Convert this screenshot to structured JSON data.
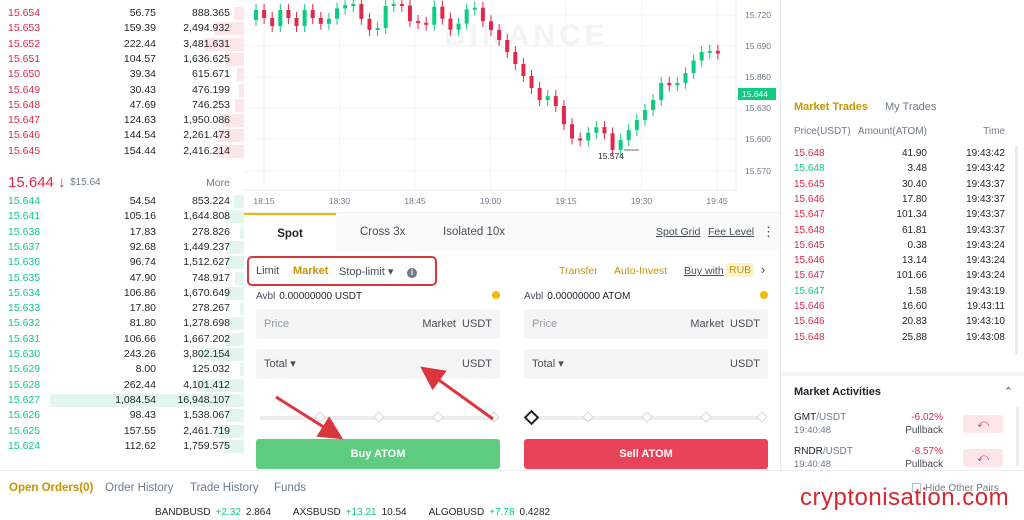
{
  "orderbook": {
    "asks": [
      {
        "price": "15.654",
        "amount": "56.75",
        "total": "888.365"
      },
      {
        "price": "15.653",
        "amount": "159.39",
        "total": "2,494.932"
      },
      {
        "price": "15.652",
        "amount": "222.44",
        "total": "3,481.631"
      },
      {
        "price": "15.651",
        "amount": "104.57",
        "total": "1,636.625"
      },
      {
        "price": "15.650",
        "amount": "39.34",
        "total": "615.671"
      },
      {
        "price": "15.649",
        "amount": "30.43",
        "total": "476.199"
      },
      {
        "price": "15.648",
        "amount": "47.69",
        "total": "746.253"
      },
      {
        "price": "15.647",
        "amount": "124.63",
        "total": "1,950.086"
      },
      {
        "price": "15.646",
        "amount": "144.54",
        "total": "2,261.473"
      },
      {
        "price": "15.645",
        "amount": "154.44",
        "total": "2,416.214"
      }
    ],
    "last_price": "15.644 ↓",
    "last_fiat": "$15.64",
    "more_label": "More",
    "bids": [
      {
        "price": "15.644",
        "amount": "54.54",
        "total": "853.224"
      },
      {
        "price": "15.641",
        "amount": "105.16",
        "total": "1,644.808"
      },
      {
        "price": "15.638",
        "amount": "17.83",
        "total": "278.826"
      },
      {
        "price": "15.637",
        "amount": "92.68",
        "total": "1,449.237"
      },
      {
        "price": "15.636",
        "amount": "96.74",
        "total": "1,512.627"
      },
      {
        "price": "15.635",
        "amount": "47.90",
        "total": "748.917"
      },
      {
        "price": "15.634",
        "amount": "106.86",
        "total": "1,670.649"
      },
      {
        "price": "15.633",
        "amount": "17.80",
        "total": "278.267"
      },
      {
        "price": "15.632",
        "amount": "81.80",
        "total": "1,278.698"
      },
      {
        "price": "15.631",
        "amount": "106.66",
        "total": "1,667.202"
      },
      {
        "price": "15.630",
        "amount": "243.26",
        "total": "3,802.154"
      },
      {
        "price": "15.629",
        "amount": "8.00",
        "total": "125.032"
      },
      {
        "price": "15.628",
        "amount": "262.44",
        "total": "4,101.412"
      },
      {
        "price": "15.627",
        "amount": "1,084.54",
        "total": "16,948.107"
      },
      {
        "price": "15.626",
        "amount": "98.43",
        "total": "1,538.067"
      },
      {
        "price": "15.625",
        "amount": "157.55",
        "total": "2,461.719"
      },
      {
        "price": "15.624",
        "amount": "112.62",
        "total": "1,759.575"
      }
    ]
  },
  "chart": {
    "watermark": "BINANCE",
    "price_ticks": [
      "15.720",
      "15.690",
      "15.860",
      "15.630",
      "15.600",
      "15.570"
    ],
    "current_price": "15.644",
    "low_label": "15.574",
    "time_ticks": [
      "18:15",
      "18:30",
      "18:45",
      "19:00",
      "19:15",
      "19:30",
      "19:45"
    ],
    "colors": {
      "up": "#0ecb81",
      "down": "#e0294a"
    }
  },
  "trade": {
    "tabs": {
      "spot": "Spot",
      "cross": "Cross 3x",
      "isolated": "Isolated 10x"
    },
    "links": {
      "spot_grid": "Spot Grid",
      "fee_level": "Fee Level"
    },
    "order_types": {
      "limit": "Limit",
      "market": "Market",
      "stop_limit": "Stop-limit ▾"
    },
    "info_glyph": "i",
    "options": {
      "transfer": "Transfer",
      "auto_invest": "Auto-Invest",
      "buy_with": "Buy with",
      "currency": "RUB",
      "next": "›"
    },
    "buy": {
      "avbl_label": "Avbl",
      "avbl_value": "0.00000000 USDT",
      "price_label": "Price",
      "price_mode": "Market",
      "price_unit": "USDT",
      "total_label": "Total ▾",
      "total_unit": "USDT",
      "button": "Buy ATOM"
    },
    "sell": {
      "avbl_label": "Avbl",
      "avbl_value": "0.00000000 ATOM",
      "price_label": "Price",
      "price_mode": "Market",
      "price_unit": "USDT",
      "total_label": "Total ▾",
      "total_unit": "USDT",
      "button": "Sell ATOM"
    }
  },
  "trades": {
    "tabs": {
      "market": "Market Trades",
      "mine": "My Trades"
    },
    "headers": {
      "price": "Price(USDT)",
      "amount": "Amount(ATOM)",
      "time": "Time"
    },
    "rows": [
      {
        "price": "15.648",
        "amount": "41.90",
        "time": "19:43:42",
        "side": "sell"
      },
      {
        "price": "15.648",
        "amount": "3.48",
        "time": "19:43:42",
        "side": "buy"
      },
      {
        "price": "15.645",
        "amount": "30.40",
        "time": "19:43:37",
        "side": "sell"
      },
      {
        "price": "15.646",
        "amount": "17.80",
        "time": "19:43:37",
        "side": "sell"
      },
      {
        "price": "15.647",
        "amount": "101.34",
        "time": "19:43:37",
        "side": "sell"
      },
      {
        "price": "15.648",
        "amount": "61.81",
        "time": "19:43:37",
        "side": "sell"
      },
      {
        "price": "15.645",
        "amount": "0.38",
        "time": "19:43:24",
        "side": "sell"
      },
      {
        "price": "15.646",
        "amount": "13.14",
        "time": "19:43:24",
        "side": "sell"
      },
      {
        "price": "15.647",
        "amount": "101.66",
        "time": "19:43:24",
        "side": "sell"
      },
      {
        "price": "15.647",
        "amount": "1.58",
        "time": "19:43:19",
        "side": "buy"
      },
      {
        "price": "15.646",
        "amount": "16.60",
        "time": "19:43:11",
        "side": "sell"
      },
      {
        "price": "15.646",
        "amount": "20.83",
        "time": "19:43:10",
        "side": "sell"
      },
      {
        "price": "15.648",
        "amount": "25.88",
        "time": "19:43:08",
        "side": "sell"
      }
    ]
  },
  "activities": {
    "title": "Market Activities",
    "collapse_glyph": "⌃",
    "items": [
      {
        "base": "GMT",
        "quote": "/USDT",
        "time": "19:40:48",
        "change": "-6.02%",
        "kind": "Pullback"
      },
      {
        "base": "RNDR",
        "quote": "/USDT",
        "time": "19:40:48",
        "change": "-8.57%",
        "kind": "Pullback"
      }
    ],
    "button_glyph": "⤺"
  },
  "bottom": {
    "tabs": {
      "open": "Open Orders(0)",
      "history": "Order History",
      "trades": "Trade History",
      "funds": "Funds"
    },
    "hide_other": "Hide Other Pairs",
    "ticker": [
      {
        "pair": "BANDBUSD",
        "change": "+2.32",
        "price": "2.864"
      },
      {
        "pair": "AXSBUSD",
        "change": "+13.21",
        "price": "10.54"
      },
      {
        "pair": "ALGOBUSD",
        "change": "+7.78",
        "price": "0.4282"
      }
    ]
  },
  "watermark": "cryptonisation.com"
}
